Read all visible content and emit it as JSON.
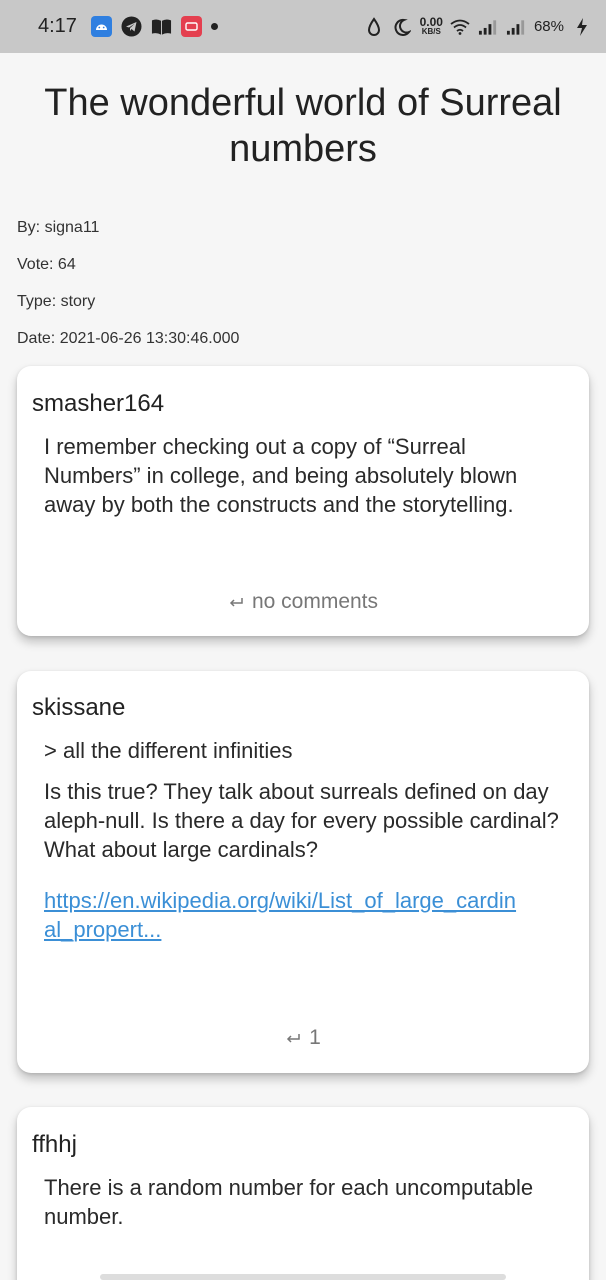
{
  "status_bar": {
    "time": "4:17",
    "net_speed_value": "0.00",
    "net_speed_unit": "KB/S",
    "battery": "68%"
  },
  "story": {
    "title": "The wonderful world of Surreal numbers",
    "by": "By: signa11",
    "vote": "Vote: 64",
    "type": "Type: story",
    "date": "Date: 2021-06-26 13:30:46.000"
  },
  "comments": [
    {
      "author": "smasher164",
      "text": "I remember checking out a copy of “Surreal Numbers” in college, and being absolutely blown away by both the constructs and the storytelling.",
      "replies": "no comments"
    },
    {
      "author": "skissane",
      "quote": "> all the different infinities",
      "text": "Is this true? They talk about surreals defined on day aleph-null. Is there a day for every possible cardinal? What about large cardinals?",
      "link": "https://en.wikipedia.org/wiki/List_of_large_cardinal_propert...",
      "replies": "1"
    },
    {
      "author": "ffhhj",
      "text": "There is a random number for each uncomputable number."
    }
  ]
}
